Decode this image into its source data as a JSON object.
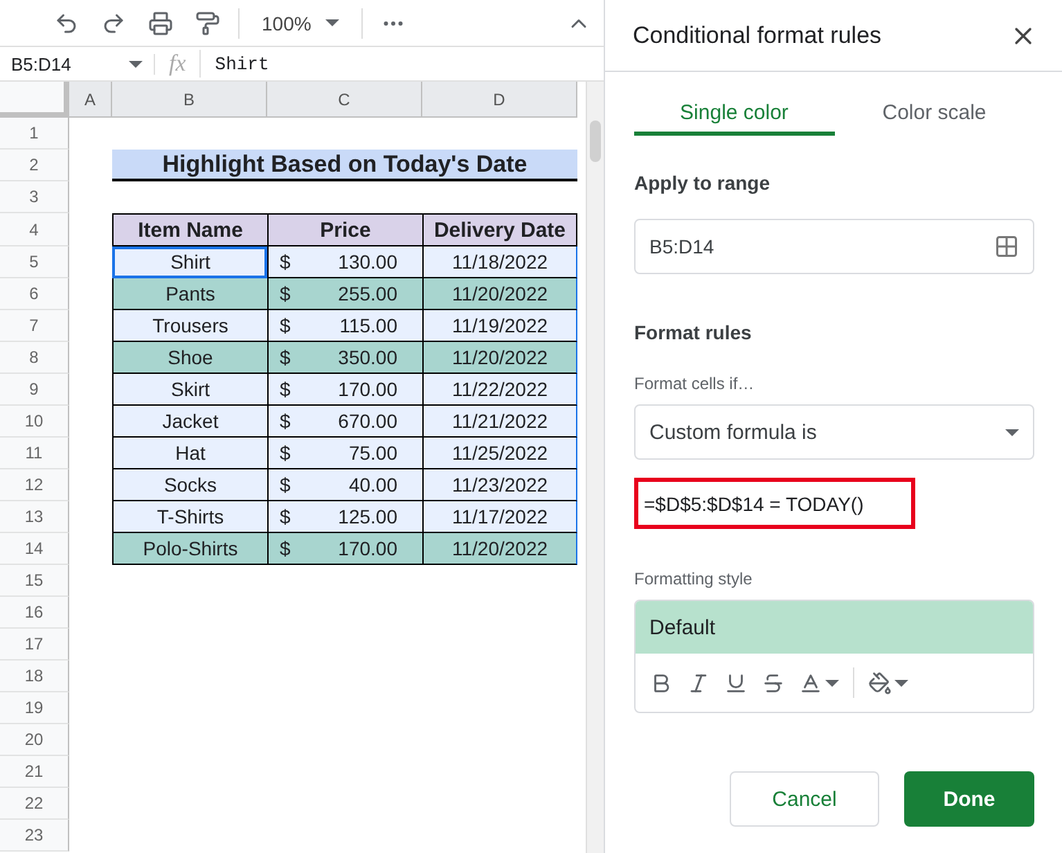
{
  "toolbar": {
    "zoom": "100%"
  },
  "formula_bar": {
    "name_box": "B5:D14",
    "fx": "fx",
    "value": "Shirt"
  },
  "columns": [
    "A",
    "B",
    "C",
    "D"
  ],
  "rows": [
    {
      "number": "1",
      "kind": "blank"
    },
    {
      "number": "2",
      "kind": "title",
      "text": "Highlight Based on Today's Date"
    },
    {
      "number": "3",
      "kind": "blank"
    },
    {
      "number": "4",
      "kind": "header",
      "cells": [
        "Item Name",
        "Price",
        "Delivery Date"
      ]
    },
    {
      "number": "5",
      "kind": "data",
      "item": "Shirt",
      "currency": "$",
      "price": "130.00",
      "date": "11/18/2022",
      "highlighted": false,
      "active": true
    },
    {
      "number": "6",
      "kind": "data",
      "item": "Pants",
      "currency": "$",
      "price": "255.00",
      "date": "11/20/2022",
      "highlighted": true,
      "active": false
    },
    {
      "number": "7",
      "kind": "data",
      "item": "Trousers",
      "currency": "$",
      "price": "115.00",
      "date": "11/19/2022",
      "highlighted": false,
      "active": false
    },
    {
      "number": "8",
      "kind": "data",
      "item": "Shoe",
      "currency": "$",
      "price": "350.00",
      "date": "11/20/2022",
      "highlighted": true,
      "active": false
    },
    {
      "number": "9",
      "kind": "data",
      "item": "Skirt",
      "currency": "$",
      "price": "170.00",
      "date": "11/22/2022",
      "highlighted": false,
      "active": false
    },
    {
      "number": "10",
      "kind": "data",
      "item": "Jacket",
      "currency": "$",
      "price": "670.00",
      "date": "11/21/2022",
      "highlighted": false,
      "active": false
    },
    {
      "number": "11",
      "kind": "data",
      "item": "Hat",
      "currency": "$",
      "price": "75.00",
      "date": "11/25/2022",
      "highlighted": false,
      "active": false
    },
    {
      "number": "12",
      "kind": "data",
      "item": "Socks",
      "currency": "$",
      "price": "40.00",
      "date": "11/23/2022",
      "highlighted": false,
      "active": false
    },
    {
      "number": "13",
      "kind": "data",
      "item": "T-Shirts",
      "currency": "$",
      "price": "125.00",
      "date": "11/17/2022",
      "highlighted": false,
      "active": false
    },
    {
      "number": "14",
      "kind": "data",
      "item": "Polo-Shirts",
      "currency": "$",
      "price": "170.00",
      "date": "11/20/2022",
      "highlighted": true,
      "active": false
    },
    {
      "number": "15",
      "kind": "blank"
    },
    {
      "number": "16",
      "kind": "blank"
    },
    {
      "number": "17",
      "kind": "blank"
    },
    {
      "number": "18",
      "kind": "blank"
    },
    {
      "number": "19",
      "kind": "blank"
    },
    {
      "number": "20",
      "kind": "blank"
    },
    {
      "number": "21",
      "kind": "blank"
    },
    {
      "number": "22",
      "kind": "blank"
    },
    {
      "number": "23",
      "kind": "blank"
    }
  ],
  "panel": {
    "title": "Conditional format rules",
    "tabs": [
      {
        "label": "Single color",
        "selected": true
      },
      {
        "label": "Color scale",
        "selected": false
      }
    ],
    "apply_label": "Apply to range",
    "range": "B5:D14",
    "rules_label": "Format rules",
    "condition_label": "Format cells if…",
    "condition": "Custom formula is",
    "formula": "=$D$5:$D$14 = TODAY()",
    "style_label": "Formatting style",
    "style_preview": "Default",
    "buttons": [
      {
        "label": "Cancel",
        "kind": "secondary"
      },
      {
        "label": "Done",
        "kind": "primary"
      }
    ]
  }
}
